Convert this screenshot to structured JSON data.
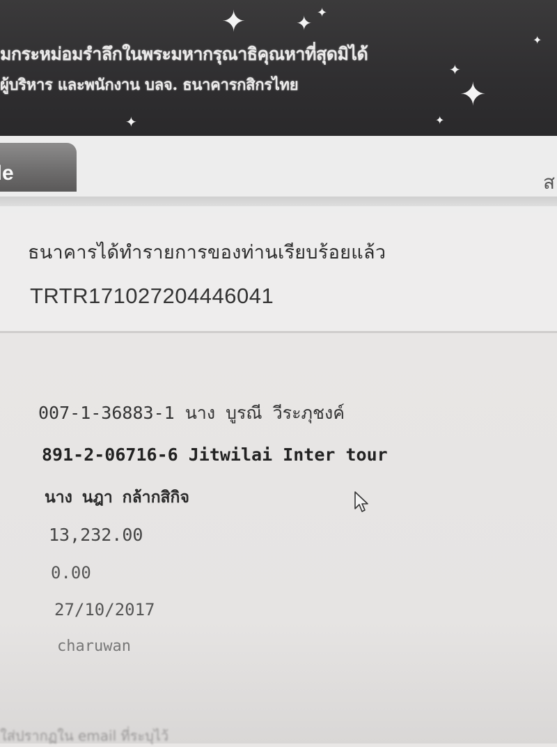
{
  "banner": {
    "line1": "มกระหม่อมรำลึกในพระมหากรุณาธิคุณหาที่สุดมิได้",
    "line2": "ผู้บริหาร และพนักงาน บลจ. ธนาคารกสิกรไทย",
    "sparkle_glyph": "✦"
  },
  "tabs": {
    "active_label": "ade",
    "right_label": "ส"
  },
  "result": {
    "status": "ธนาคารได้ทำรายการของท่านเรียบร้อยแล้ว",
    "reference": "TRTR171027204446041"
  },
  "transfer": {
    "from_account": "007-1-36883-1 นาง บูรณี วีระภุชงค์",
    "to_account": "891-2-06716-6 Jitwilai Inter tour",
    "to_name": "นาง นฎา กล้ากสิกิจ",
    "amount": "13,232.00",
    "fee": "0.00",
    "date": "27/10/2017",
    "user": "charuwan"
  },
  "footer": {
    "partial_text": "ใส่ปรากฏใน email ที่ระบุไว้"
  },
  "colors": {
    "banner": "#2f2e30",
    "tab": "#6f6e6e",
    "background": "#e9e7e6"
  }
}
